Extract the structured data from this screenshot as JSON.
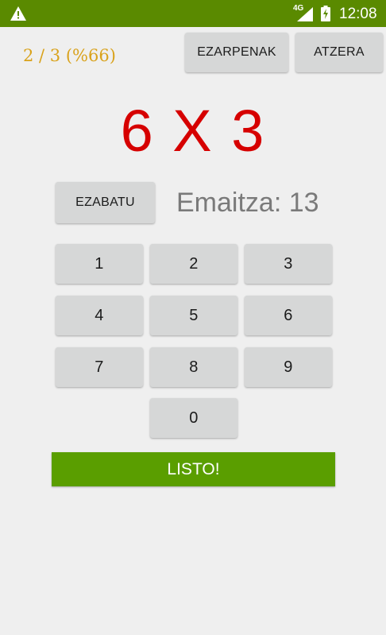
{
  "status_bar": {
    "network": "4G",
    "time": "12:08",
    "icons": [
      "warning-icon",
      "signal-icon",
      "battery-charging-icon"
    ]
  },
  "header": {
    "score": "2 / 3 (%66)",
    "settings_label": "EZARPENAK",
    "back_label": "ATZERA"
  },
  "problem": "6 X 3",
  "answer": {
    "clear_label": "EZABATU",
    "result_text": "Emaitza: 13"
  },
  "keypad": {
    "keys": [
      "1",
      "2",
      "3",
      "4",
      "5",
      "6",
      "7",
      "8",
      "9",
      "0"
    ]
  },
  "done_label": "LISTO!",
  "colors": {
    "status_bar": "#5a8a00",
    "score": "#d9a21b",
    "problem": "#d60000",
    "done_button": "#5a9e00",
    "button": "#d6d7d7"
  }
}
